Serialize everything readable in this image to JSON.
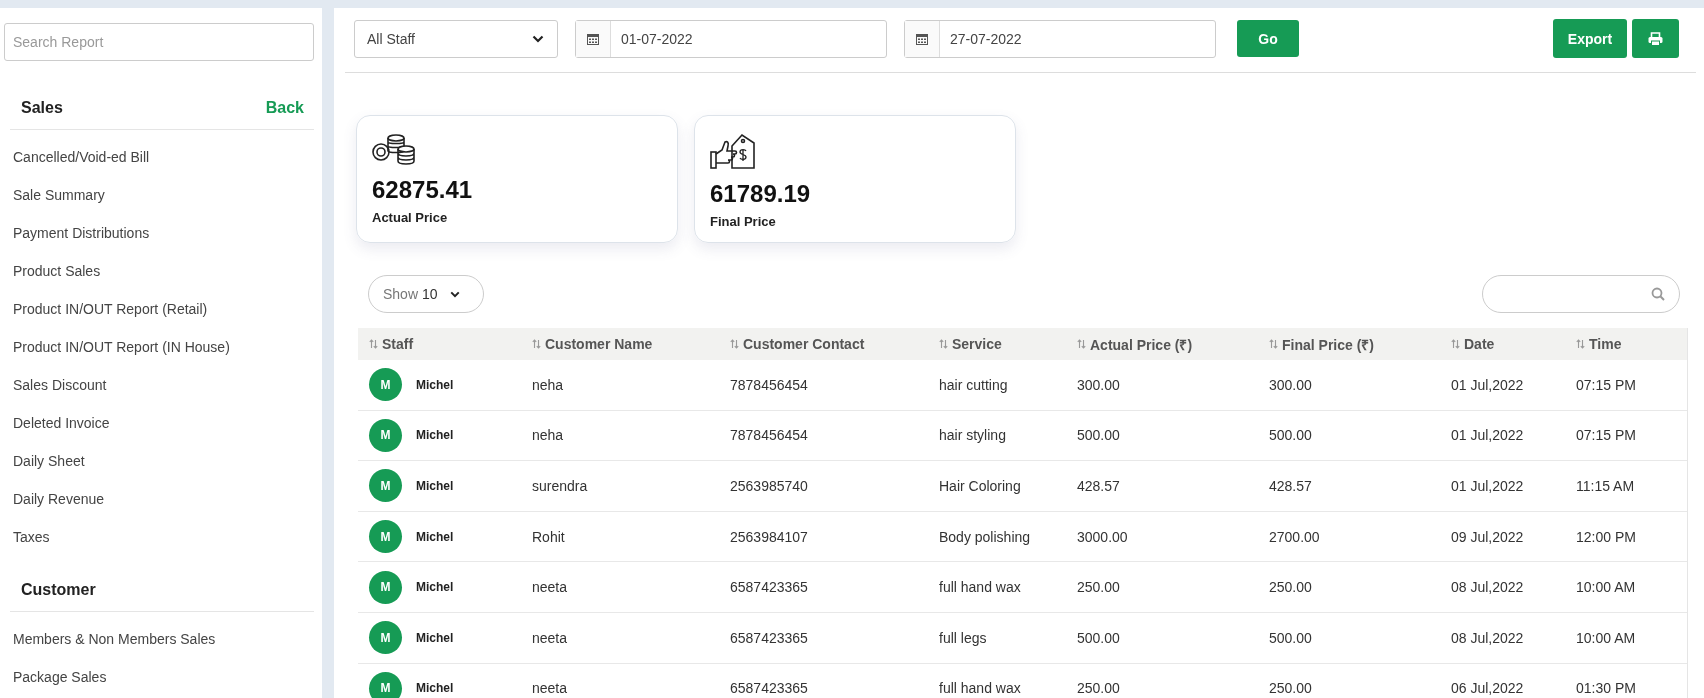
{
  "sidebar": {
    "search": {
      "placeholder": "Search Report"
    },
    "sections": [
      {
        "title": "Sales",
        "back": "Back",
        "items": [
          "Cancelled/Void-ed Bill",
          "Sale Summary",
          "Payment Distributions",
          "Product Sales",
          "Product IN/OUT Report (Retail)",
          "Product IN/OUT Report (IN House)",
          "Sales Discount",
          "Deleted Invoice",
          "Daily Sheet",
          "Daily Revenue",
          "Taxes"
        ]
      },
      {
        "title": "Customer",
        "items": [
          "Members & Non Members Sales",
          "Package Sales"
        ]
      }
    ]
  },
  "filters": {
    "staff": "All Staff",
    "from": "01-07-2022",
    "to": "27-07-2022",
    "go": "Go",
    "export": "Export"
  },
  "cards": [
    {
      "kind": "coins",
      "value": "62875.41",
      "label": "Actual Price"
    },
    {
      "kind": "price-tag",
      "value": "61789.19",
      "label": "Final Price"
    }
  ],
  "table": {
    "show_label": "Show",
    "page_size": "10",
    "columns": [
      "Staff",
      "Customer Name",
      "Customer Contact",
      "Service",
      "Actual Price (₹)",
      "Final Price (₹)",
      "Date",
      "Time"
    ],
    "rows": [
      {
        "initial": "M",
        "cells": [
          "Michel",
          "neha",
          "7878456454",
          "hair cutting",
          "300.00",
          "300.00",
          "01 Jul,2022",
          "07:15 PM"
        ]
      },
      {
        "initial": "M",
        "cells": [
          "Michel",
          "neha",
          "7878456454",
          "hair styling",
          "500.00",
          "500.00",
          "01 Jul,2022",
          "07:15 PM"
        ]
      },
      {
        "initial": "M",
        "cells": [
          "Michel",
          "surendra",
          "2563985740",
          "Hair Coloring",
          "428.57",
          "428.57",
          "01 Jul,2022",
          "11:15 AM"
        ]
      },
      {
        "initial": "M",
        "cells": [
          "Michel",
          "Rohit",
          "2563984107",
          "Body polishing",
          "3000.00",
          "2700.00",
          "09 Jul,2022",
          "12:00 PM"
        ]
      },
      {
        "initial": "M",
        "cells": [
          "Michel",
          "neeta",
          "6587423365",
          "full hand wax",
          "250.00",
          "250.00",
          "08 Jul,2022",
          "10:00 AM"
        ]
      },
      {
        "initial": "M",
        "cells": [
          "Michel",
          "neeta",
          "6587423365",
          "full legs",
          "500.00",
          "500.00",
          "08 Jul,2022",
          "10:00 AM"
        ]
      },
      {
        "initial": "M",
        "cells": [
          "Michel",
          "neeta",
          "6587423365",
          "full hand wax",
          "250.00",
          "250.00",
          "06 Jul,2022",
          "01:30 PM"
        ]
      }
    ]
  }
}
